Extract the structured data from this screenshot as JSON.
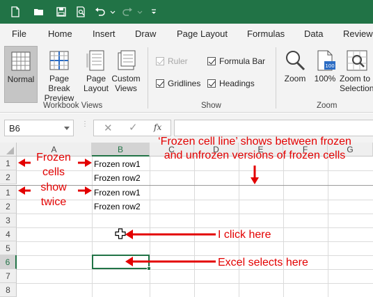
{
  "qat": {
    "icons": [
      "new-file-icon",
      "open-folder-icon",
      "save-icon",
      "print-preview-icon",
      "undo-icon",
      "redo-icon",
      "customize-qat-icon"
    ]
  },
  "ribbon_tabs": [
    "File",
    "Home",
    "Insert",
    "Draw",
    "Page Layout",
    "Formulas",
    "Data",
    "Review"
  ],
  "workbook_views": {
    "label": "Workbook Views",
    "buttons": [
      {
        "line1": "Normal",
        "line2": "",
        "selected": true
      },
      {
        "line1": "Page Break",
        "line2": "Preview",
        "selected": false
      },
      {
        "line1": "Page",
        "line2": "Layout",
        "selected": false
      },
      {
        "line1": "Custom",
        "line2": "Views",
        "selected": false
      }
    ]
  },
  "show": {
    "label": "Show",
    "ruler": "Ruler",
    "formula_bar": "Formula Bar",
    "gridlines": "Gridlines",
    "headings": "Headings"
  },
  "zoom": {
    "label": "Zoom",
    "zoom_btn": "Zoom",
    "hundred_btn": "100%",
    "zoom_sel_line1": "Zoom to",
    "zoom_sel_line2": "Selection"
  },
  "formula_bar": {
    "name_box": "B6",
    "fx": "fx",
    "value": ""
  },
  "sheet": {
    "columns": [
      "A",
      "B",
      "C",
      "D",
      "E",
      "F",
      "G"
    ],
    "row_headers": [
      "1",
      "2",
      "1",
      "2",
      "3",
      "4",
      "5",
      "6",
      "7",
      "8"
    ],
    "cells": {
      "b_frozen1": "Frozen row1",
      "b_frozen2": "Frozen row2",
      "b_row1": "Frozen row1",
      "b_row2": "Frozen row2"
    },
    "selected_cell": "B6"
  },
  "annotations": {
    "frozen_cells": [
      "Frozen",
      "cells",
      "show",
      "twice"
    ],
    "freeze_line_line1": "‘Frozen cell line’ shows between frozen",
    "freeze_line_line2": "and unfrozen versions of frozen cells",
    "i_click": "I click here",
    "excel_selects": "Excel selects here"
  },
  "colors": {
    "excel_green": "#217346",
    "annotation_red": "#e30000"
  }
}
